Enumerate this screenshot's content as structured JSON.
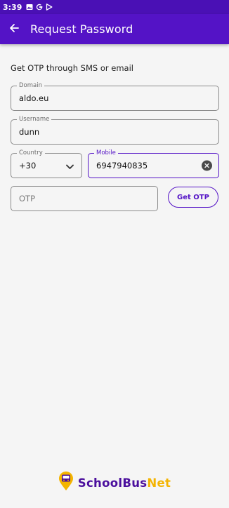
{
  "status_bar": {
    "time": "3:39"
  },
  "app_bar": {
    "title": "Request Password"
  },
  "form": {
    "subtitle": "Get OTP through SMS or email",
    "domain": {
      "label": "Domain",
      "value": "aldo.eu"
    },
    "username": {
      "label": "Username",
      "value": "dunn"
    },
    "country": {
      "label": "Country",
      "value": "+30"
    },
    "mobile": {
      "label": "Mobile",
      "value": "6947940835"
    },
    "otp": {
      "placeholder": "OTP"
    },
    "get_otp_label": "Get OTP"
  },
  "brand": {
    "part1": "SchoolBus",
    "part2": "Net"
  },
  "colors": {
    "primary": "#5413c6",
    "status_bar": "#4a10b5",
    "accent": "#f4b400",
    "background": "#f5f5f5"
  },
  "icons": [
    "image-icon",
    "google-g-icon",
    "play-store-icon",
    "back-arrow-icon",
    "chevron-down-icon",
    "clear-icon",
    "bus-pin-logo-icon"
  ]
}
